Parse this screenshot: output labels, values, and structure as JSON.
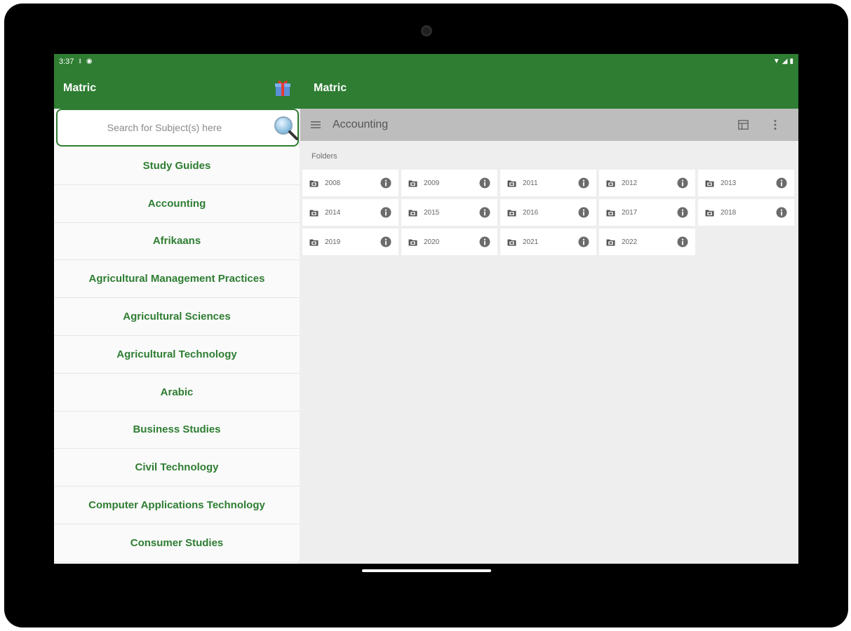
{
  "status_bar": {
    "time": "3:37"
  },
  "app_bar": {
    "left_title": "Matric",
    "right_title": "Matric"
  },
  "search": {
    "placeholder": "Search for Subject(s) here"
  },
  "subjects": [
    "Study Guides",
    "Accounting",
    "Afrikaans",
    "Agricultural Management Practices",
    "Agricultural Sciences",
    "Agricultural Technology",
    "Arabic",
    "Business Studies",
    "Civil Technology",
    "Computer Applications Technology",
    "Consumer Studies"
  ],
  "toolbar": {
    "title": "Accounting"
  },
  "folders_section": {
    "label": "Folders",
    "items": [
      "2008",
      "2009",
      "2011",
      "2012",
      "2013",
      "2014",
      "2015",
      "2016",
      "2017",
      "2018",
      "2019",
      "2020",
      "2021",
      "2022"
    ]
  },
  "colors": {
    "primary": "#2e7d32",
    "toolbar": "#bdbdbd",
    "background": "#eeeeee"
  },
  "icons": [
    "download-icon",
    "sync-icon",
    "wifi-icon",
    "signal-icon",
    "battery-icon",
    "gift-icon",
    "search-icon",
    "menu-icon",
    "grid-view-icon",
    "more-vert-icon",
    "folder-icon",
    "info-icon"
  ]
}
